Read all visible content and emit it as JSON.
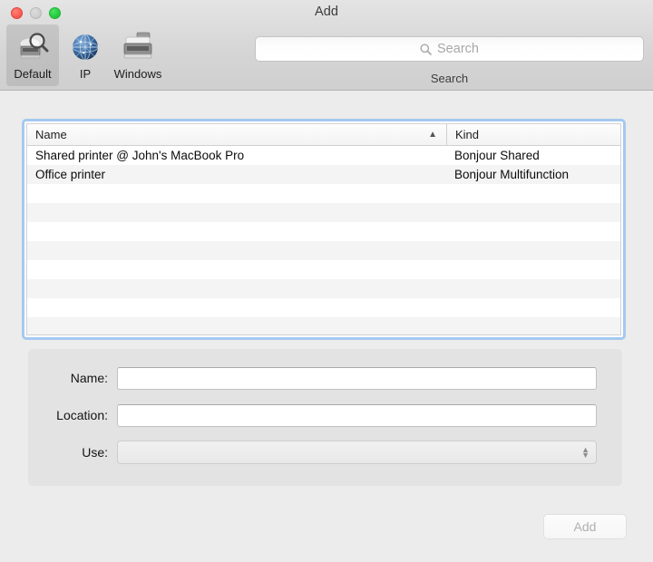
{
  "window": {
    "title": "Add",
    "traffic_lights": [
      {
        "name": "close",
        "color": "#fc5f56"
      },
      {
        "name": "minimize",
        "color": "#cfcfcf"
      },
      {
        "name": "zoom",
        "color": "#27cd42"
      }
    ]
  },
  "toolbar": {
    "tabs": [
      {
        "label": "Default",
        "icon": "printer-search-icon",
        "selected": true
      },
      {
        "label": "IP",
        "icon": "globe-network-icon",
        "selected": false
      },
      {
        "label": "Windows",
        "icon": "printer-multifunction-icon",
        "selected": false
      }
    ],
    "search": {
      "placeholder": "Search",
      "value": "",
      "icon": "search-icon",
      "caption": "Search"
    }
  },
  "table": {
    "columns": [
      {
        "label": "Name",
        "sort": "ascending",
        "sort_icon": "chevron-up-icon"
      },
      {
        "label": "Kind",
        "sort": "none"
      }
    ],
    "rows": [
      {
        "name": "Shared printer @ John's MacBook Pro",
        "kind": "Bonjour Shared"
      },
      {
        "name": "Office printer",
        "kind": "Bonjour Multifunction"
      }
    ],
    "empty_row_count": 9,
    "focus_ring_color": "#a5c9ef"
  },
  "form": {
    "fields": [
      {
        "label": "Name:",
        "value": "",
        "type": "text"
      },
      {
        "label": "Location:",
        "value": "",
        "type": "text"
      },
      {
        "label": "Use:",
        "value": "",
        "type": "popup",
        "icon": "stepper-updown-icon",
        "enabled": false
      }
    ]
  },
  "footer": {
    "add_button": {
      "label": "Add",
      "enabled": false
    }
  }
}
